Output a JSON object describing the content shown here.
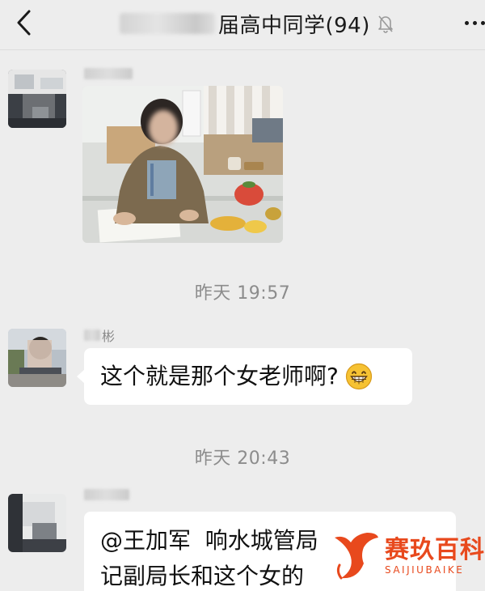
{
  "header": {
    "title": "届高中同学(94)",
    "back_icon": "chevron-left-icon",
    "mute_icon": "bell-muted-icon",
    "more_icon": "more-dots-icon"
  },
  "messages": [
    {
      "type": "image",
      "sender_name": "",
      "content": "photo"
    },
    {
      "type": "timestamp",
      "text": "昨天 19:57"
    },
    {
      "type": "text",
      "sender_name": "彬",
      "text": "这个就是那个女老师啊?",
      "emoji": "grin-emoji"
    },
    {
      "type": "timestamp",
      "text": "昨天 20:43"
    },
    {
      "type": "text",
      "sender_name": "",
      "line1": "@王加军  响水城管局",
      "line2": "记副局长和这个女的"
    }
  ],
  "watermark": {
    "cn": "赛玖百科",
    "en": "SAIJIUBAIKE"
  },
  "colors": {
    "background": "#ededed",
    "bubble": "#ffffff",
    "watermark": "#e8491d"
  }
}
